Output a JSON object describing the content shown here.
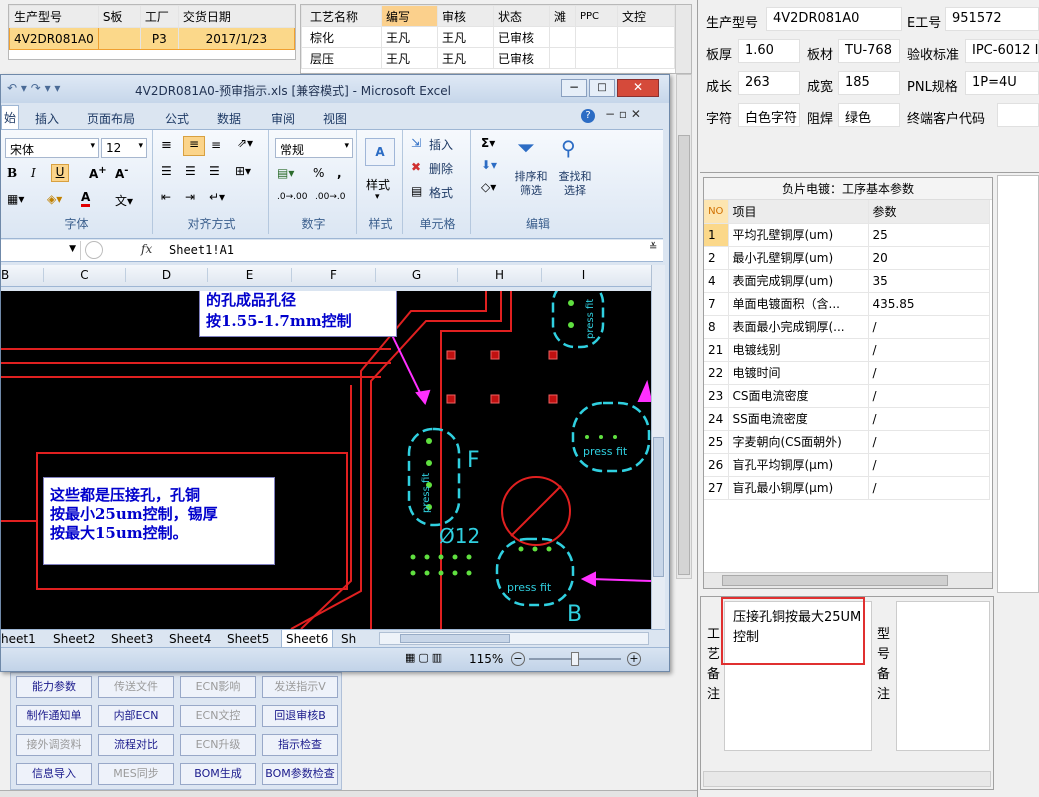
{
  "order_grid": {
    "headers": [
      "生产型号",
      "S板",
      "工厂",
      "交货日期"
    ],
    "row": [
      "4V2DR081A0",
      "",
      "P3",
      "2017/1/23"
    ]
  },
  "process_grid": {
    "headers": [
      "工艺名称",
      "编写",
      "审核",
      "状态",
      "滩",
      "PPC",
      "文控"
    ],
    "rows": [
      [
        "棕化",
        "王凡",
        "王凡",
        "已审核",
        "",
        "",
        ""
      ],
      [
        "层压",
        "王凡",
        "王凡",
        "已审核",
        "",
        "",
        ""
      ]
    ]
  },
  "info": {
    "model_label": "生产型号",
    "model_value": "4V2DR081A0",
    "eng_label": "E工号",
    "eng_value": "951572",
    "thick_label": "板厚",
    "thick_value": "1.60",
    "material_label": "板材",
    "material_value": "TU-768",
    "std_label": "验收标准",
    "std_value": "IPC-6012 I",
    "len_label": "成长",
    "len_value": "263",
    "width_label": "成宽",
    "width_value": "185",
    "pnl_label": "PNL规格",
    "pnl_value": "1P=4U",
    "char_label": "字符",
    "char_value": "白色字符",
    "mask_label": "阻焊",
    "mask_value": "绿色",
    "cust_label": "终端客户代码",
    "cust_value": ""
  },
  "params": {
    "title": "负片电镀：工序基本参数",
    "col_no": "NO",
    "col_item": "项目",
    "col_param": "参数",
    "rows": [
      {
        "no": "1",
        "item": "平均孔壁铜厚(um)",
        "val": "25"
      },
      {
        "no": "2",
        "item": "最小孔壁铜厚(um)",
        "val": "20"
      },
      {
        "no": "4",
        "item": "表面完成铜厚(um)",
        "val": "35"
      },
      {
        "no": "7",
        "item": "单面电镀面积（含...",
        "val": "435.85"
      },
      {
        "no": "8",
        "item": "表面最小完成铜厚(...",
        "val": "/"
      },
      {
        "no": "21",
        "item": "电镀线别",
        "val": "/"
      },
      {
        "no": "22",
        "item": "电镀时间",
        "val": "/"
      },
      {
        "no": "23",
        "item": "CS面电流密度",
        "val": "/"
      },
      {
        "no": "24",
        "item": "SS面电流密度",
        "val": "/"
      },
      {
        "no": "25",
        "item": "字麦朝向(CS面朝外)",
        "val": "/"
      },
      {
        "no": "26",
        "item": "盲孔平均铜厚(μm)",
        "val": "/"
      },
      {
        "no": "27",
        "item": "盲孔最小铜厚(μm)",
        "val": "/"
      }
    ]
  },
  "remarks": {
    "process_label": "工艺备注",
    "process_text": "压接孔铜按最大25UM控制",
    "model_label": "型号备注"
  },
  "excel": {
    "title": "4V2DR081A0-预审指示.xls  [兼容模式] - Microsoft Excel",
    "tabs": [
      "始",
      "插入",
      "页面布局",
      "公式",
      "数据",
      "审阅",
      "视图"
    ],
    "font_name": "宋体",
    "font_size": "12",
    "number_format": "常规",
    "group_font": "字体",
    "group_align": "对齐方式",
    "group_number": "数字",
    "group_style": "样式",
    "group_cells": "单元格",
    "group_edit": "编辑",
    "style_btn": "样式",
    "insert_btn": "插入",
    "delete_btn": "删除",
    "format_btn": "格式",
    "sort_btn": "排序和\n筛选",
    "find_btn": "查找和\n选择",
    "cell_ref": "",
    "formula": "Sheet1!A1",
    "columns": [
      "B",
      "C",
      "D",
      "E",
      "F",
      "G",
      "H",
      "I"
    ],
    "callout1": "的孔成品孔径\n按1.55-1.7mm控制",
    "callout2": "这些都是压接孔，孔铜\n按最小25um控制，锡厚\n按最大15um控制。",
    "sheets": [
      "heet1",
      "Sheet2",
      "Sheet3",
      "Sheet4",
      "Sheet5",
      "Sheet6",
      "Sh"
    ],
    "zoom": "115%",
    "pcb_labels": {
      "f": "F",
      "b": "B",
      "dia": "Ø12",
      "press": "press fit"
    }
  },
  "buttons": [
    {
      "label": "能力参数",
      "disabled": false
    },
    {
      "label": "传送文件",
      "disabled": true
    },
    {
      "label": "ECN影响",
      "disabled": true
    },
    {
      "label": "发送指示V",
      "disabled": true
    },
    {
      "label": "制作通知单",
      "disabled": false
    },
    {
      "label": "内部ECN",
      "disabled": false
    },
    {
      "label": "ECN文控",
      "disabled": true
    },
    {
      "label": "回退审核B",
      "disabled": false
    },
    {
      "label": "接外调资料",
      "disabled": true
    },
    {
      "label": "流程对比",
      "disabled": false
    },
    {
      "label": "ECN升级",
      "disabled": true
    },
    {
      "label": "指示检查",
      "disabled": false
    },
    {
      "label": "信息导入",
      "disabled": false
    },
    {
      "label": "MES同步",
      "disabled": true
    },
    {
      "label": "BOM生成",
      "disabled": false
    },
    {
      "label": "BOM参数检查",
      "disabled": false
    }
  ]
}
